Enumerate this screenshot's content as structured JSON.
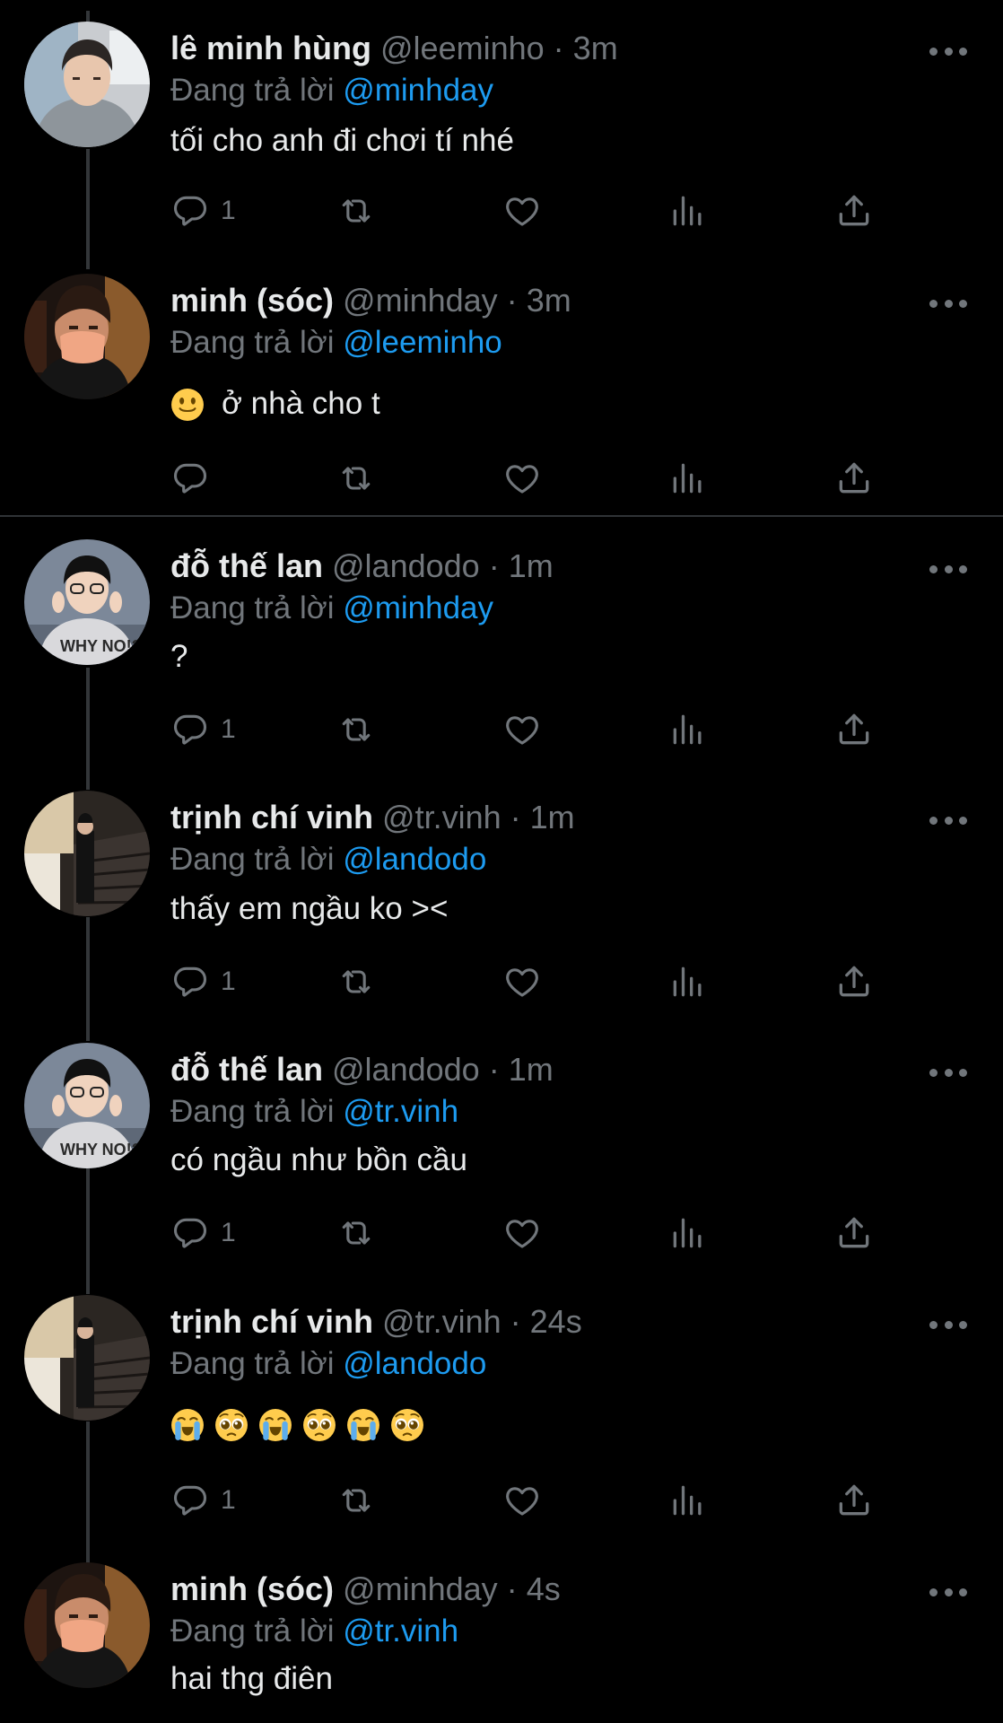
{
  "colors": {
    "background": "#000000",
    "text": "#e7e9ea",
    "muted": "#71767b",
    "accent": "#1d9bf0"
  },
  "reply_prefix": "Đang trả lời",
  "icons": {
    "more": "more-icon",
    "reply": "reply-icon",
    "retweet": "retweet-icon",
    "like": "heart-icon",
    "views": "analytics-icon",
    "share": "share-icon"
  },
  "tweets": [
    {
      "name": "lê minh hùng",
      "handle": "@leeminho",
      "sep": "·",
      "time": "3m",
      "replying_to": "@minhday",
      "text": "tối cho anh đi chơi tí nhé",
      "reply_count": "1",
      "avatar": "avatar-leeminho"
    },
    {
      "name": "minh (sóc)",
      "handle": "@minhday",
      "sep": "·",
      "time": "3m",
      "replying_to": "@leeminho",
      "emoji": [
        "slightly-smiling-face"
      ],
      "text": "ở nhà cho t",
      "reply_count": "",
      "avatar": "avatar-minhday"
    },
    {
      "name": "đỗ thế lan",
      "handle": "@landodo",
      "sep": "·",
      "time": "1m",
      "replying_to": "@minhday",
      "text": "?",
      "reply_count": "1",
      "avatar": "avatar-landodo"
    },
    {
      "name": "trịnh chí vinh",
      "handle": "@tr.vinh",
      "sep": "·",
      "time": "1m",
      "replying_to": "@landodo",
      "text": "thấy em ngầu ko ><",
      "reply_count": "1",
      "avatar": "avatar-trvinh"
    },
    {
      "name": "đỗ thế lan",
      "handle": "@landodo",
      "sep": "·",
      "time": "1m",
      "replying_to": "@tr.vinh",
      "text": "có ngầu như bồn cầu",
      "reply_count": "1",
      "avatar": "avatar-landodo"
    },
    {
      "name": "trịnh chí vinh",
      "handle": "@tr.vinh",
      "sep": "·",
      "time": "24s",
      "replying_to": "@landodo",
      "emoji": [
        "loudly-crying-face",
        "pleading-face",
        "loudly-crying-face",
        "pleading-face",
        "loudly-crying-face",
        "pleading-face"
      ],
      "text": "",
      "reply_count": "1",
      "avatar": "avatar-trvinh"
    },
    {
      "name": "minh (sóc)",
      "handle": "@minhday",
      "sep": "·",
      "time": "4s",
      "replying_to": "@tr.vinh",
      "text": "hai thg điên",
      "reply_count": "",
      "avatar": "avatar-minhday"
    }
  ]
}
